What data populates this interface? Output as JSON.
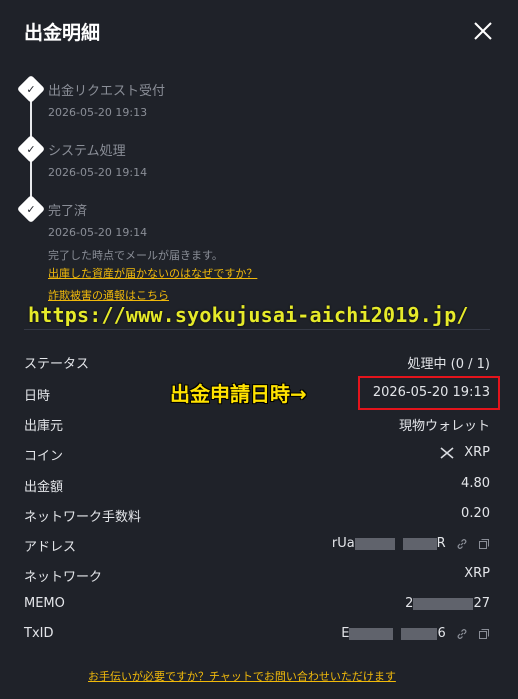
{
  "header": {
    "title": "出金明細"
  },
  "steps": [
    {
      "label": "出金リクエスト受付",
      "time": "2026-05-20 19:13"
    },
    {
      "label": "システム処理",
      "time": "2026-05-20 19:14"
    },
    {
      "label": "完了済",
      "time": "2026-05-20 19:14"
    }
  ],
  "note": "完了した時点でメールが届きます。",
  "links": {
    "faq": "出庫した資産が届かないのはなぜですか？",
    "fraud": "詐欺被害の通報はこちら",
    "help": "お手伝いが必要ですか？チャットでお問い合わせいただけます"
  },
  "overlay": {
    "url": "https://www.syokujusai-aichi2019.jp/",
    "annotation": "出金申請日時→"
  },
  "details": {
    "status_label": "ステータス",
    "status_value": "処理中 (0 / 1)",
    "date_label": "日時",
    "date_value": "2026-05-20 19:13",
    "source_label": "出庫元",
    "source_value": "現物ウォレット",
    "coin_label": "コイン",
    "coin_value": "XRP",
    "amount_label": "出金額",
    "amount_value": "4.80",
    "fee_label": "ネットワーク手数料",
    "fee_value": "0.20",
    "address_label": "アドレス",
    "address_prefix": "rUa",
    "address_suffix": "R",
    "network_label": "ネットワーク",
    "network_value": "XRP",
    "memo_label": "MEMO",
    "memo_prefix": "2",
    "memo_suffix": "27",
    "txid_label": "TxID",
    "txid_prefix": "E",
    "txid_suffix": "6"
  },
  "colors": {
    "accent": "#f0b90b",
    "highlight_box": "#e4141c",
    "annotation": "#ffe200",
    "url_overlay": "#e6ea2a"
  },
  "icons": {
    "close": "close-icon",
    "check": "check-icon",
    "coin": "xrp-coin-icon",
    "link": "link-icon",
    "copy": "copy-icon"
  }
}
